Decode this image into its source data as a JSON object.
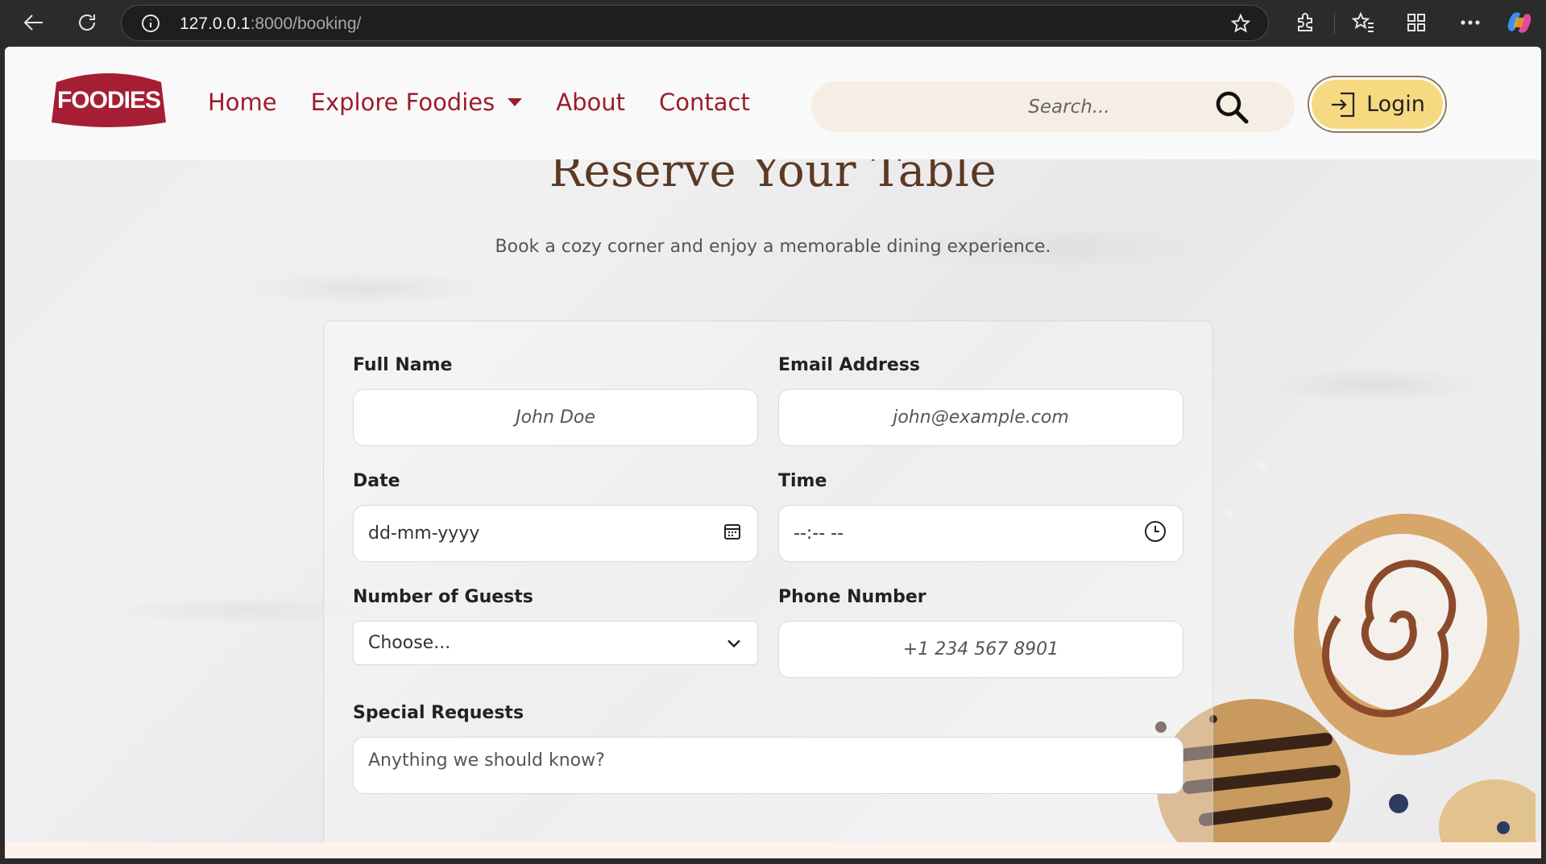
{
  "browser": {
    "url_host": "127.0.0.1",
    "url_rest": ":8000/booking/"
  },
  "navbar": {
    "logo_text": "FOODIES",
    "links": [
      {
        "label": "Home"
      },
      {
        "label": "Explore Foodies"
      },
      {
        "label": "About"
      },
      {
        "label": "Contact"
      }
    ],
    "search_placeholder": "Search...",
    "login_label": "Login"
  },
  "hero": {
    "title": "Reserve Your Table",
    "subtitle": "Book a cozy corner and enjoy a memorable dining experience."
  },
  "form": {
    "full_name": {
      "label": "Full Name",
      "placeholder": "John Doe"
    },
    "email": {
      "label": "Email Address",
      "placeholder": "john@example.com"
    },
    "date": {
      "label": "Date",
      "value": "dd-mm-yyyy"
    },
    "time": {
      "label": "Time",
      "value": "--:-- --"
    },
    "guests": {
      "label": "Number of Guests",
      "value": "Choose..."
    },
    "phone": {
      "label": "Phone Number",
      "placeholder": "+1 234 567 8901"
    },
    "requests": {
      "label": "Special Requests",
      "placeholder": "Anything we should know?"
    }
  },
  "colors": {
    "brand": "#9b1d2a",
    "title": "#5a3a24",
    "login_bg": "#f7d982",
    "submit": "#1565e6"
  }
}
